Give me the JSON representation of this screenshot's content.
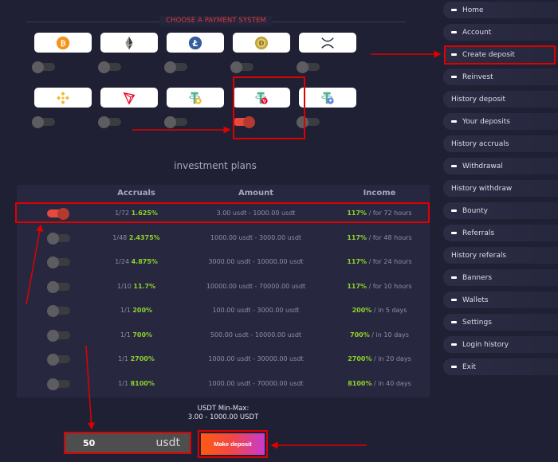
{
  "payment": {
    "title": "CHOOSE A PAYMENT SYSTEM",
    "systems": [
      {
        "name": "Bitcoin",
        "icon": "bitcoin-icon",
        "selected": false
      },
      {
        "name": "Ethereum",
        "icon": "ethereum-icon",
        "selected": false
      },
      {
        "name": "Litecoin",
        "icon": "litecoin-icon",
        "selected": false
      },
      {
        "name": "Dogecoin",
        "icon": "dogecoin-icon",
        "selected": false
      },
      {
        "name": "XRP",
        "icon": "xrp-icon",
        "selected": false
      },
      {
        "name": "BNB",
        "icon": "bnb-icon",
        "selected": false
      },
      {
        "name": "TRON",
        "icon": "tron-icon",
        "selected": false
      },
      {
        "name": "USDT BEP20",
        "icon": "usdt-bep20-icon",
        "selected": false
      },
      {
        "name": "USDT TRC20",
        "icon": "usdt-trc20-icon",
        "selected": true
      },
      {
        "name": "USDT ERC20",
        "icon": "usdt-erc20-icon",
        "selected": false
      }
    ]
  },
  "plans": {
    "title": "investment plans",
    "headers": {
      "accruals": "Accruals",
      "amount": "Amount",
      "income": "Income"
    },
    "rows": [
      {
        "period": "1/72",
        "rate": "1.625%",
        "amount": "3.00 usdt - 1000.00 usdt",
        "income_pct": "117%",
        "income_term": " / for 72 hours",
        "selected": true
      },
      {
        "period": "1/48",
        "rate": "2.4375%",
        "amount": "1000.00 usdt - 3000.00 usdt",
        "income_pct": "117%",
        "income_term": " / for 48 hours",
        "selected": false
      },
      {
        "period": "1/24",
        "rate": "4.875%",
        "amount": "3000.00 usdt - 10000.00 usdt",
        "income_pct": "117%",
        "income_term": " / for 24 hours",
        "selected": false
      },
      {
        "period": "1/10",
        "rate": "11.7%",
        "amount": "10000.00 usdt - 70000.00 usdt",
        "income_pct": "117%",
        "income_term": " / for 10 hours",
        "selected": false
      },
      {
        "period": "1/1",
        "rate": "200%",
        "amount": "100.00 usdt - 3000.00 usdt",
        "income_pct": "200%",
        "income_term": " / in 5 days",
        "selected": false
      },
      {
        "period": "1/1",
        "rate": "700%",
        "amount": "500.00 usdt - 10000.00 usdt",
        "income_pct": "700%",
        "income_term": " / in 10 days",
        "selected": false
      },
      {
        "period": "1/1",
        "rate": "2700%",
        "amount": "1000.00 usdt - 30000.00 usdt",
        "income_pct": "2700%",
        "income_term": " / in 20 days",
        "selected": false
      },
      {
        "period": "1/1",
        "rate": "8100%",
        "amount": "1000.00 usdt - 70000.00 usdt",
        "income_pct": "8100%",
        "income_term": " / in 40 days",
        "selected": false
      }
    ]
  },
  "form": {
    "minmax_label": "USDT Min-Max:",
    "minmax_range": "3.00 - 1000.00 USDT",
    "amount_value": "50",
    "amount_unit": "usdt",
    "submit_label": "Make deposit"
  },
  "sidebar": {
    "items": [
      {
        "label": "Home",
        "dash": true
      },
      {
        "label": "Account",
        "dash": true
      },
      {
        "label": "Create deposit",
        "dash": true,
        "highlighted": true
      },
      {
        "label": "Reinvest",
        "dash": true
      },
      {
        "label": "History deposit",
        "dash": false
      },
      {
        "label": "Your deposits",
        "dash": true
      },
      {
        "label": "History accruals",
        "dash": false
      },
      {
        "label": "Withdrawal",
        "dash": true
      },
      {
        "label": "History withdraw",
        "dash": false
      },
      {
        "label": "Bounty",
        "dash": true
      },
      {
        "label": "Referrals",
        "dash": true
      },
      {
        "label": "History referals",
        "dash": false
      },
      {
        "label": "Banners",
        "dash": true
      },
      {
        "label": "Wallets",
        "dash": true
      },
      {
        "label": "Settings",
        "dash": true
      },
      {
        "label": "Login history",
        "dash": true
      },
      {
        "label": "Exit",
        "dash": true
      }
    ]
  },
  "colors": {
    "background": "#1f2034",
    "accent_red": "#e00000",
    "toggle_on": "#e8493d",
    "highlight_green": "#8fd22a"
  }
}
